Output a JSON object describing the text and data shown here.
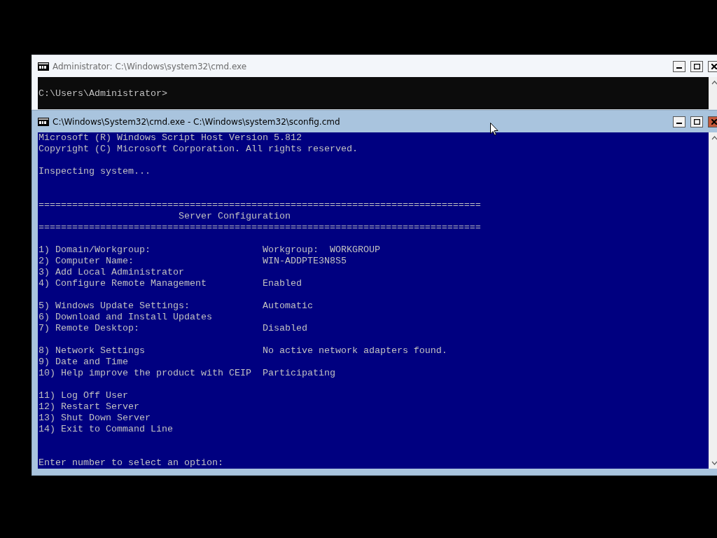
{
  "windows": [
    {
      "title": "Administrator: C:\\Windows\\system32\\cmd.exe",
      "active": false,
      "lines": [
        "C:\\Users\\Administrator>"
      ]
    },
    {
      "title": "C:\\Windows\\System32\\cmd.exe - C:\\Windows\\system32\\sconfig.cmd",
      "active": true,
      "header_lines": [
        "Microsoft (R) Windows Script Host Version 5.812",
        "Copyright (C) Microsoft Corporation. All rights reserved."
      ],
      "status_line": "Inspecting system...",
      "banner": {
        "rule": "===============================================================================",
        "title": "Server Configuration"
      },
      "menu_groups": [
        {
          "items": [
            {
              "option": "1) Domain/Workgroup:",
              "value": "Workgroup:  WORKGROUP"
            },
            {
              "option": "2) Computer Name:",
              "value": "WIN-ADDPTE3N8S5"
            },
            {
              "option": "3) Add Local Administrator"
            },
            {
              "option": "4) Configure Remote Management",
              "value": "Enabled"
            }
          ]
        },
        {
          "items": [
            {
              "option": "5) Windows Update Settings:",
              "value": "Automatic"
            },
            {
              "option": "6) Download and Install Updates"
            },
            {
              "option": "7) Remote Desktop:",
              "value": "Disabled"
            }
          ]
        },
        {
          "items": [
            {
              "option": "8) Network Settings",
              "value": "No active network adapters found."
            },
            {
              "option": "9) Date and Time"
            },
            {
              "option": "10) Help improve the product with CEIP",
              "value": "Participating"
            }
          ]
        },
        {
          "items": [
            {
              "option": "11) Log Off User"
            },
            {
              "option": "12) Restart Server"
            },
            {
              "option": "13) Shut Down Server"
            },
            {
              "option": "14) Exit to Command Line"
            }
          ]
        }
      ],
      "prompt": "Enter number to select an option:"
    }
  ]
}
